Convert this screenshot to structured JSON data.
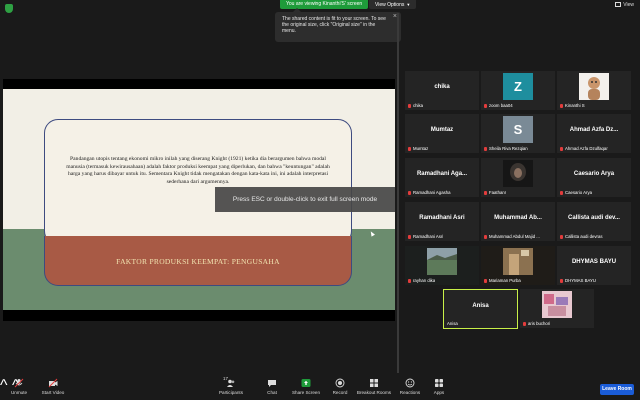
{
  "top": {
    "viewing_text": "You are viewing Kinanthi'S' screen",
    "view_options_label": "View Options",
    "view_label": "View",
    "tooltip_text": "The shared content is fit to your screen. To see the original size, click \"Original size\" in the menu."
  },
  "slide": {
    "body_text": "Pandangan utopis tentang ekonomi mikro inilah yang diserang Knight (1921) ketika dia berargumen bahwa modal manusia (termasuk kewirausahaan) adalah faktor produksi keempat yang diperlukan, dan bahwa \"keuntungan\" adalah harga yang harus dibayar untuk itu. Sementara Knight tidak mengatakan dengan kata-kata ini, ini adalah interpretasi sederhana dari argumennya.",
    "title": "FAKTOR PRODUKSI KEEMPAT: PENGUSAHA"
  },
  "overlay": {
    "esc_text": "Press ESC or double-click to exit full screen mode"
  },
  "gallery": [
    {
      "center": "chika",
      "label": "chika"
    },
    {
      "avatar": "Z",
      "label": "zoom baa04"
    },
    {
      "label": "Kinanthi S"
    },
    {
      "center": "Mumtaz",
      "label": "Mumtaz"
    },
    {
      "avatar": "S",
      "label": "Sheila Riva Rezqian"
    },
    {
      "center": "Ahmad Azfa Dz...",
      "label": "Ahmad Azfa Dzulfaqar"
    },
    {
      "center": "Ramadhani Aga...",
      "label": "Ramadhani Agasha"
    },
    {
      "label": "Faathanr"
    },
    {
      "center": "Caesario Arya",
      "label": "Caesario Arya"
    },
    {
      "center": "Ramadhani Asri",
      "label": "Ramadhani Asri"
    },
    {
      "center": "Muhammad Ab...",
      "label": "Muhammad Abdul Majid ..."
    },
    {
      "center": "Callista audi dev...",
      "label": "Callista audi devras"
    },
    {
      "label": "rayhan dika"
    },
    {
      "label": "Mariaman Purba"
    },
    {
      "center": "DHYMAS BAYU",
      "label": "DHYMAS BAYU"
    },
    {
      "center": "Anisa",
      "label": "Anisa"
    },
    {
      "label": "aris buchori"
    }
  ],
  "toolbar": {
    "unmute": "Unmute",
    "start_video": "Start Video",
    "participants": "Participants",
    "participants_count": "17",
    "chat": "Chat",
    "share_screen": "Share Screen",
    "record": "Record",
    "breakout_rooms": "Breakout Rooms",
    "reactions": "Reactions",
    "apps": "Apps",
    "leave_room": "Leave Room"
  },
  "colors": {
    "share_screen_accent": "#1e9b3a",
    "leave_button": "#1a5cd8",
    "active_speaker_border": "#c8f048",
    "muted_mic": "#e23c3c"
  }
}
